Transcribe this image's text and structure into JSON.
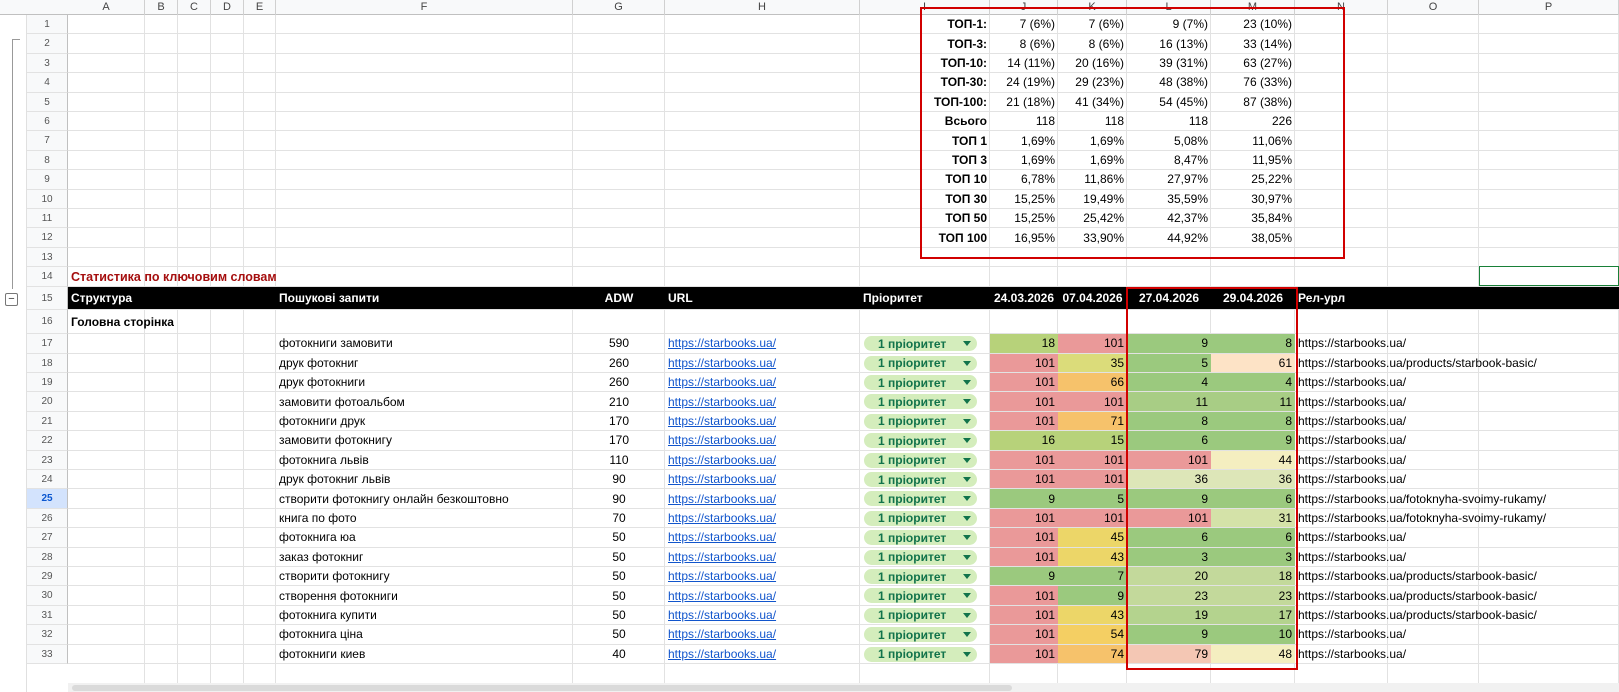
{
  "columns": [
    "A",
    "B",
    "C",
    "D",
    "E",
    "F",
    "G",
    "H",
    "I",
    "J",
    "K",
    "L",
    "M",
    "N",
    "O",
    "P"
  ],
  "row_numbers": [
    "1",
    "2",
    "3",
    "4",
    "5",
    "6",
    "7",
    "8",
    "9",
    "10",
    "11",
    "12",
    "13",
    "14",
    "15",
    "16",
    "17",
    "18",
    "19",
    "20",
    "21",
    "22",
    "23",
    "24",
    "25",
    "26",
    "27",
    "28",
    "29",
    "30",
    "31",
    "32",
    "33"
  ],
  "selected_row": "25",
  "group_toggle": "−",
  "stats": [
    {
      "label": "ТОП-1:",
      "j": "7 (6%)",
      "k": "7 (6%)",
      "l": "9 (7%)",
      "m": "23 (10%)"
    },
    {
      "label": "ТОП-3:",
      "j": "8 (6%)",
      "k": "8 (6%)",
      "l": "16 (13%)",
      "m": "33 (14%)"
    },
    {
      "label": "ТОП-10:",
      "j": "14 (11%)",
      "k": "20 (16%)",
      "l": "39 (31%)",
      "m": "63 (27%)"
    },
    {
      "label": "ТОП-30:",
      "j": "24 (19%)",
      "k": "29 (23%)",
      "l": "48 (38%)",
      "m": "76 (33%)"
    },
    {
      "label": "ТОП-100:",
      "j": "21 (18%)",
      "k": "41 (34%)",
      "l": "54 (45%)",
      "m": "87 (38%)"
    },
    {
      "label": "Всього",
      "j": "118",
      "k": "118",
      "l": "118",
      "m": "226"
    },
    {
      "label": "ТОП 1",
      "j": "1,69%",
      "k": "1,69%",
      "l": "5,08%",
      "m": "11,06%"
    },
    {
      "label": "ТОП 3",
      "j": "1,69%",
      "k": "1,69%",
      "l": "8,47%",
      "m": "11,95%"
    },
    {
      "label": "ТОП 10",
      "j": "6,78%",
      "k": "11,86%",
      "l": "27,97%",
      "m": "25,22%"
    },
    {
      "label": "ТОП 30",
      "j": "15,25%",
      "k": "19,49%",
      "l": "35,59%",
      "m": "30,97%"
    },
    {
      "label": "ТОП 50",
      "j": "15,25%",
      "k": "25,42%",
      "l": "42,37%",
      "m": "35,84%"
    },
    {
      "label": "ТОП 100",
      "j": "16,95%",
      "k": "33,90%",
      "l": "44,92%",
      "m": "38,05%"
    }
  ],
  "section_title": "Статистика по ключовим словам",
  "header": {
    "structure": "Структура",
    "queries": "Пошукові запити",
    "adw": "ADW",
    "url": "URL",
    "priority": "Пріоритет",
    "d1": "24.03.2026",
    "d2": "07.04.2026",
    "d3": "27.04.2026",
    "d4": "29.04.2026",
    "rel": "Рел-урл"
  },
  "group_title": "Головна сторінка",
  "rows": [
    {
      "q": "фотокниги замовити",
      "adw": "590",
      "url": "https://starbooks.ua/",
      "p": "1 пріоритет",
      "d1": "18",
      "d2": "101",
      "d3": "9",
      "d4": "8",
      "rel": "https://starbooks.ua/",
      "c1": "#b7d27a",
      "c2": "#ea9999",
      "c3": "#9bc97e",
      "c4": "#9bc97e"
    },
    {
      "q": "друк фотокниг",
      "adw": "260",
      "url": "https://starbooks.ua/",
      "p": "1 пріоритет",
      "d1": "101",
      "d2": "35",
      "d3": "5",
      "d4": "61",
      "rel": "https://starbooks.ua/products/starbook-basic/",
      "c1": "#ea9999",
      "c2": "#dbdc7a",
      "c3": "#9bc97e",
      "c4": "#fde3c6"
    },
    {
      "q": "друк фотокниги",
      "adw": "260",
      "url": "https://starbooks.ua/",
      "p": "1 пріоритет",
      "d1": "101",
      "d2": "66",
      "d3": "4",
      "d4": "4",
      "rel": "https://starbooks.ua/",
      "c1": "#ea9999",
      "c2": "#f6c26b",
      "c3": "#9bc97e",
      "c4": "#9bc97e"
    },
    {
      "q": "замовити фотоальбом",
      "adw": "210",
      "url": "https://starbooks.ua/",
      "p": "1 пріоритет",
      "d1": "101",
      "d2": "101",
      "d3": "11",
      "d4": "11",
      "rel": "https://starbooks.ua/",
      "c1": "#ea9999",
      "c2": "#ea9999",
      "c3": "#a8cd85",
      "c4": "#a8cd85"
    },
    {
      "q": "фотокниги друк",
      "adw": "170",
      "url": "https://starbooks.ua/",
      "p": "1 пріоритет",
      "d1": "101",
      "d2": "71",
      "d3": "8",
      "d4": "8",
      "rel": "https://starbooks.ua/",
      "c1": "#ea9999",
      "c2": "#f6c26b",
      "c3": "#9bc97e",
      "c4": "#9bc97e"
    },
    {
      "q": "замовити фотокнигу",
      "adw": "170",
      "url": "https://starbooks.ua/",
      "p": "1 пріоритет",
      "d1": "16",
      "d2": "15",
      "d3": "6",
      "d4": "9",
      "rel": "https://starbooks.ua/",
      "c1": "#b7d27a",
      "c2": "#b7d27a",
      "c3": "#9bc97e",
      "c4": "#9bc97e"
    },
    {
      "q": "фотокнига львів",
      "adw": "110",
      "url": "https://starbooks.ua/",
      "p": "1 пріоритет",
      "d1": "101",
      "d2": "101",
      "d3": "101",
      "d4": "44",
      "rel": "https://starbooks.ua/",
      "c1": "#ea9999",
      "c2": "#ea9999",
      "c3": "#ea9999",
      "c4": "#f4eec0"
    },
    {
      "q": "друк фотокниг львів",
      "adw": "90",
      "url": "https://starbooks.ua/",
      "p": "1 пріоритет",
      "d1": "101",
      "d2": "101",
      "d3": "36",
      "d4": "36",
      "rel": "https://starbooks.ua/",
      "c1": "#ea9999",
      "c2": "#ea9999",
      "c3": "#dde6b8",
      "c4": "#dde6b8"
    },
    {
      "q": "створити фотокнигу онлайн безкоштовно",
      "adw": "90",
      "url": "https://starbooks.ua/",
      "p": "1 пріоритет",
      "d1": "9",
      "d2": "5",
      "d3": "9",
      "d4": "6",
      "rel": "https://starbooks.ua/fotoknyha-svoimy-rukamy/",
      "c1": "#9bc97e",
      "c2": "#9bc97e",
      "c3": "#9bc97e",
      "c4": "#9bc97e"
    },
    {
      "q": "книга по фото",
      "adw": "70",
      "url": "https://starbooks.ua/",
      "p": "1 пріоритет",
      "d1": "101",
      "d2": "101",
      "d3": "101",
      "d4": "31",
      "rel": "https://starbooks.ua/fotoknyha-svoimy-rukamy/",
      "c1": "#ea9999",
      "c2": "#ea9999",
      "c3": "#ea9999",
      "c4": "#d4e2a8"
    },
    {
      "q": "фотокнига юа",
      "adw": "50",
      "url": "https://starbooks.ua/",
      "p": "1 пріоритет",
      "d1": "101",
      "d2": "45",
      "d3": "6",
      "d4": "6",
      "rel": "https://starbooks.ua/",
      "c1": "#ea9999",
      "c2": "#ecd668",
      "c3": "#9bc97e",
      "c4": "#9bc97e"
    },
    {
      "q": "заказ фотокниг",
      "adw": "50",
      "url": "https://starbooks.ua/",
      "p": "1 пріоритет",
      "d1": "101",
      "d2": "43",
      "d3": "3",
      "d4": "3",
      "rel": "https://starbooks.ua/",
      "c1": "#ea9999",
      "c2": "#ecd668",
      "c3": "#9bc97e",
      "c4": "#9bc97e"
    },
    {
      "q": "створити фотокнигу",
      "adw": "50",
      "url": "https://starbooks.ua/",
      "p": "1 пріоритет",
      "d1": "9",
      "d2": "7",
      "d3": "20",
      "d4": "18",
      "rel": "https://starbooks.ua/products/starbook-basic/",
      "c1": "#9bc97e",
      "c2": "#9bc97e",
      "c3": "#c3d99b",
      "c4": "#c3d99b"
    },
    {
      "q": "створення фотокниги",
      "adw": "50",
      "url": "https://starbooks.ua/",
      "p": "1 пріоритет",
      "d1": "101",
      "d2": "9",
      "d3": "23",
      "d4": "23",
      "rel": "https://starbooks.ua/products/starbook-basic/",
      "c1": "#ea9999",
      "c2": "#9bc97e",
      "c3": "#c3d99b",
      "c4": "#c3d99b"
    },
    {
      "q": "фотокнига купити",
      "adw": "50",
      "url": "https://starbooks.ua/",
      "p": "1 пріоритет",
      "d1": "101",
      "d2": "43",
      "d3": "19",
      "d4": "17",
      "rel": "https://starbooks.ua/products/starbook-basic/",
      "c1": "#ea9999",
      "c2": "#ecd668",
      "c3": "#b4d38e",
      "c4": "#b4d38e"
    },
    {
      "q": "фотокнига ціна",
      "adw": "50",
      "url": "https://starbooks.ua/",
      "p": "1 пріоритет",
      "d1": "101",
      "d2": "54",
      "d3": "9",
      "d4": "10",
      "rel": "https://starbooks.ua/",
      "c1": "#ea9999",
      "c2": "#f4cf63",
      "c3": "#9bc97e",
      "c4": "#9bc97e"
    },
    {
      "q": "фотокниги киев",
      "adw": "40",
      "url": "https://starbooks.ua/",
      "p": "1 пріоритет",
      "d1": "101",
      "d2": "74",
      "d3": "79",
      "d4": "48",
      "rel": "https://starbooks.ua/",
      "c1": "#ea9999",
      "c2": "#f6c26b",
      "c3": "#f4c7b4",
      "c4": "#f4eec0"
    }
  ]
}
